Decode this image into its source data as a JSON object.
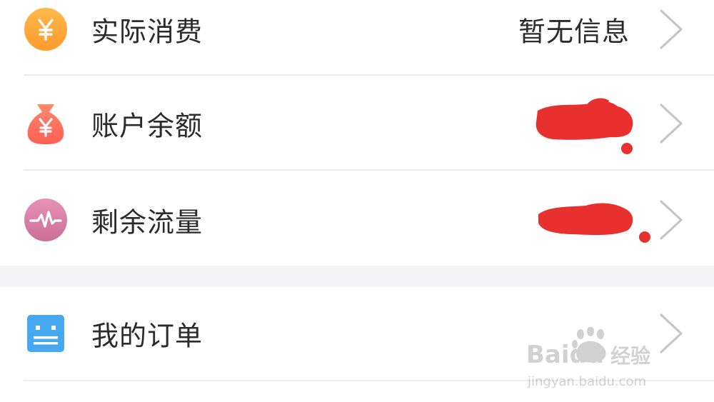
{
  "rows": [
    {
      "label": "实际消费",
      "value": "暂无信息",
      "icon": "yen-coin-icon",
      "icon_color": "#FFA53B"
    },
    {
      "label": "账户余额",
      "value": "",
      "icon": "money-bag-icon",
      "icon_color": "#FF6F5C"
    },
    {
      "label": "剩余流量",
      "value": "",
      "icon": "pulse-icon",
      "icon_color": "#D97FA6"
    },
    {
      "label": "我的订单",
      "value": "",
      "icon": "order-list-icon",
      "icon_color": "#46A8EE"
    }
  ],
  "colors": {
    "section_gap": "#f4f3f6",
    "divider": "#ececec",
    "redaction": "#e8302f",
    "chevron": "#c4c4c4"
  },
  "watermark": {
    "brand": "Baidu",
    "product": "经验",
    "url": "jingyan.baidu.com"
  }
}
